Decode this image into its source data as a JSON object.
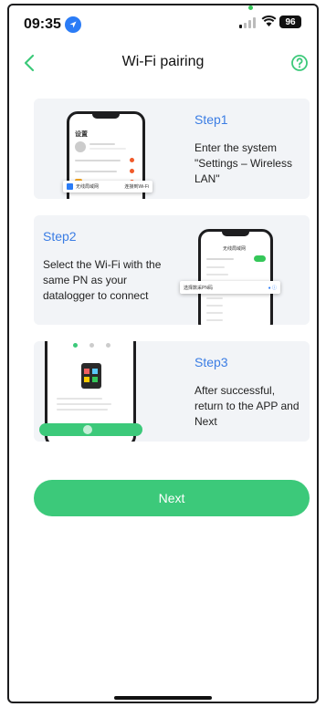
{
  "status_bar": {
    "time": "09:35",
    "battery": "96",
    "icons": [
      "location-icon",
      "signal-icon",
      "wifi-icon",
      "battery-icon"
    ]
  },
  "header": {
    "title": "Wi-Fi pairing",
    "back_icon": "chevron-left-icon",
    "help_icon": "question-circle-icon"
  },
  "steps": [
    {
      "title": "Step1",
      "description": "Enter the system \"Settings – Wireless LAN\"",
      "mock": {
        "header": "设置",
        "popup_left": "无线局域网",
        "popup_right": "连接到Wi-Fi"
      }
    },
    {
      "title": "Step2",
      "description": "Select the Wi-Fi with the same PN as your datalogger to connect",
      "mock": {
        "header": "无线局域网",
        "popup_left": "选择数采PN码"
      }
    },
    {
      "title": "Step3",
      "description": "After successful, return to the APP and Next",
      "mock": {}
    }
  ],
  "next_button": {
    "label": "Next"
  },
  "colors": {
    "accent_blue": "#3b7de4",
    "primary_green": "#3cc97a",
    "card_bg": "#f2f4f7",
    "text_dark": "#222222"
  }
}
